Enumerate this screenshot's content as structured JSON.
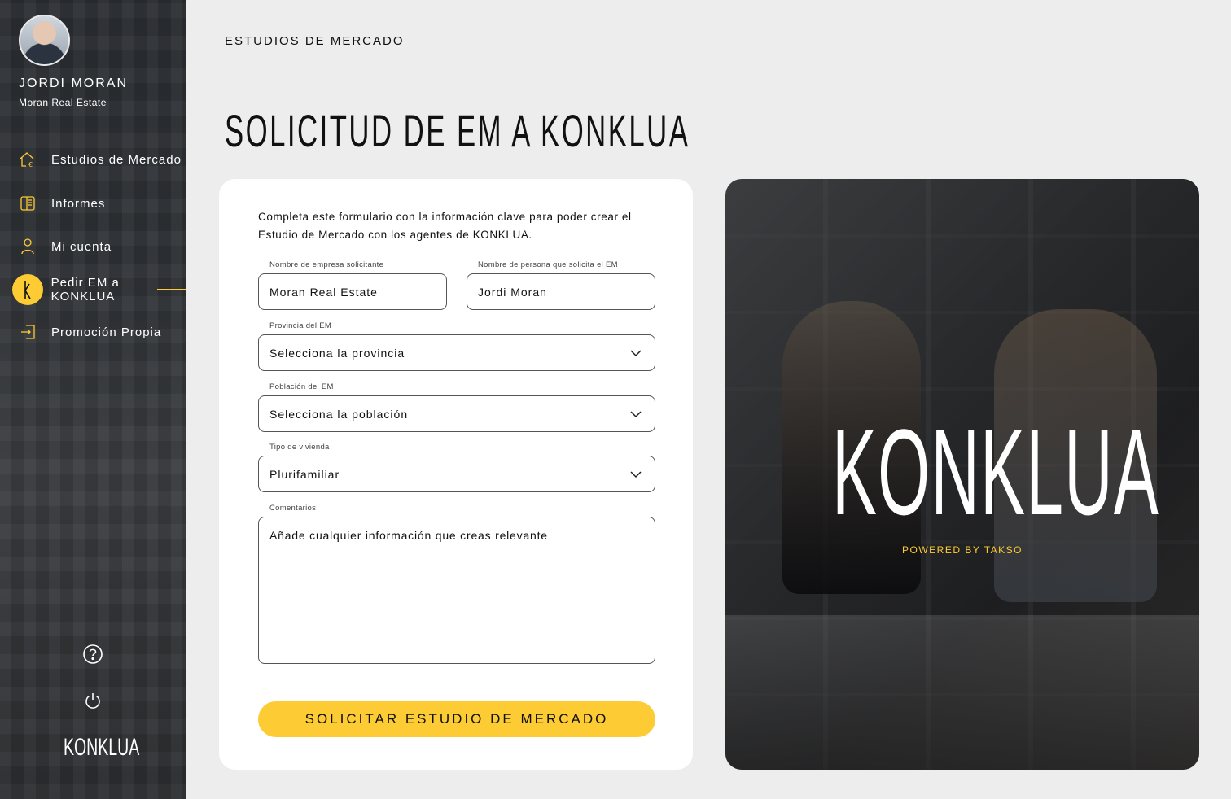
{
  "user": {
    "name": "JORDI MORAN",
    "company": "Moran Real Estate"
  },
  "nav": {
    "items": [
      {
        "label": "Estudios de Mercado",
        "icon": "home-euro-icon"
      },
      {
        "label": "Informes",
        "icon": "document-icon"
      },
      {
        "label": "Mi cuenta",
        "icon": "user-icon"
      },
      {
        "label": "Pedir EM a KONKLUA",
        "icon": "konklua-k-icon",
        "active": true
      },
      {
        "label": "Promoción Propia",
        "icon": "login-icon"
      }
    ]
  },
  "sidebar_logo": "KONKLUA",
  "breadcrumb": "ESTUDIOS DE MERCADO",
  "page_title": "SOLICITUD DE EM A KONKLUA",
  "form": {
    "intro": "Completa este formulario con la información clave para poder crear el Estudio de Mercado con los agentes de KONKLUA.",
    "company_label": "Nombre de empresa solicitante",
    "company_value": "Moran Real Estate",
    "person_label": "Nombre de persona que solicita el EM",
    "person_value": "Jordi Moran",
    "province_label": "Provincia del EM",
    "province_value": "Selecciona la provincia",
    "town_label": "Población del EM",
    "town_value": "Selecciona la población",
    "type_label": "Tipo de vivienda",
    "type_value": "Plurifamiliar",
    "comments_label": "Comentarios",
    "comments_placeholder": "Añade cualquier información que creas relevante",
    "submit_label": "SOLICITAR ESTUDIO DE MERCADO"
  },
  "hero": {
    "logo": "KONKLUA",
    "powered": "POWERED BY TAKSO"
  },
  "colors": {
    "accent": "#fdcb33",
    "sidebar_bg": "#2f3236",
    "page_bg": "#ededed"
  }
}
